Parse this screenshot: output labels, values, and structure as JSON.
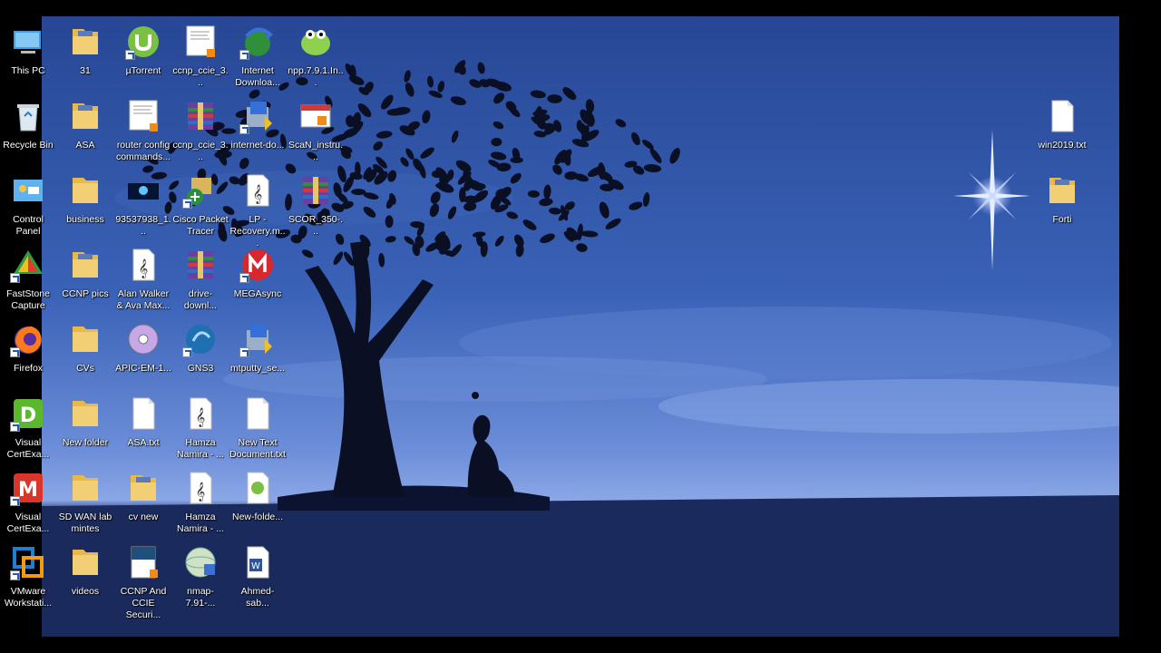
{
  "desktop": {
    "icons": [
      {
        "label": "This PC",
        "type": "pc"
      },
      {
        "label": "Recycle Bin",
        "type": "recycle"
      },
      {
        "label": "Control Panel",
        "type": "control"
      },
      {
        "label": "FastStone Capture",
        "type": "faststone"
      },
      {
        "label": "Firefox",
        "type": "firefox"
      },
      {
        "label": "Visual CertExa...",
        "type": "vce-d"
      },
      {
        "label": "Visual CertExa...",
        "type": "vce-m"
      },
      {
        "label": "VMware Workstati...",
        "type": "vmware"
      },
      {
        "label": "31",
        "type": "folder-pic"
      },
      {
        "label": "ASA",
        "type": "folder-pic"
      },
      {
        "label": "business",
        "type": "folder"
      },
      {
        "label": "CCNP pics",
        "type": "folder-pic"
      },
      {
        "label": "CVs",
        "type": "folder"
      },
      {
        "label": "New folder",
        "type": "folder"
      },
      {
        "label": "SD WAN lab mintes",
        "type": "folder"
      },
      {
        "label": "videos",
        "type": "folder"
      },
      {
        "label": "µTorrent",
        "type": "utorrent"
      },
      {
        "label": "router config commands...",
        "type": "doc-pdf"
      },
      {
        "label": "93537938_1...",
        "type": "image"
      },
      {
        "label": "Alan Walker & Ava Max...",
        "type": "audio"
      },
      {
        "label": "APIC-EM-1...",
        "type": "disc"
      },
      {
        "label": "ASA.txt",
        "type": "txt"
      },
      {
        "label": "cv new",
        "type": "folder-pic"
      },
      {
        "label": "CCNP And CCIE Securi...",
        "type": "book"
      },
      {
        "label": "ccnp_ccie_3...",
        "type": "doc-pdf"
      },
      {
        "label": "ccnp_ccie_3...",
        "type": "rar"
      },
      {
        "label": "Cisco Packet Tracer",
        "type": "packettracer"
      },
      {
        "label": "drive-downl...",
        "type": "rar"
      },
      {
        "label": "GNS3",
        "type": "gns3"
      },
      {
        "label": "Hamza Namira - ...",
        "type": "audio"
      },
      {
        "label": "Hamza Namira - ...",
        "type": "audio"
      },
      {
        "label": "nmap-7.91-...",
        "type": "nmap"
      },
      {
        "label": "Internet Downloa...",
        "type": "idm"
      },
      {
        "label": "internet-do...",
        "type": "installer"
      },
      {
        "label": "LP - Recovery.m...",
        "type": "audio"
      },
      {
        "label": "MEGAsync",
        "type": "mega"
      },
      {
        "label": "mtputty_se...",
        "type": "installer"
      },
      {
        "label": "New Text Document.txt",
        "type": "txt"
      },
      {
        "label": "New-folde...",
        "type": "torrentfile"
      },
      {
        "label": "Ahmed-sab...",
        "type": "word"
      },
      {
        "label": "npp.7.9.1.In...",
        "type": "npp"
      },
      {
        "label": "ScaN_instru...",
        "type": "scan"
      },
      {
        "label": "SCOR_350-...",
        "type": "rar"
      },
      {
        "label": "win2019.txt",
        "type": "txt"
      },
      {
        "label": "Forti",
        "type": "folder-pic"
      }
    ]
  },
  "colors": {
    "sky_top": "#2c4e9c",
    "sky_mid": "#3f67bb",
    "horizon": "#7a9be0",
    "ground": "#1b2b5e",
    "folder": "#f2cf74"
  }
}
